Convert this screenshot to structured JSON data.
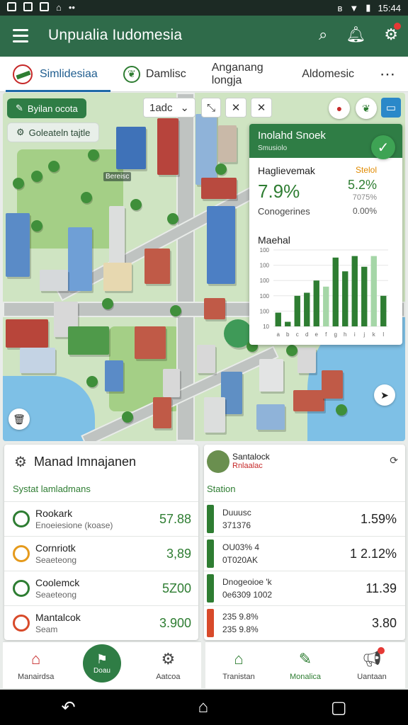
{
  "status": {
    "time": "15:44"
  },
  "appbar": {
    "title": "Unpualia Iudomesia"
  },
  "tabs": [
    {
      "label": "Simlidesiaa"
    },
    {
      "label": "Damlisc"
    },
    {
      "label": "Anganang longja"
    },
    {
      "label": "Aldomesic"
    }
  ],
  "map": {
    "chip_primary": "Byilan ocota",
    "chip_secondary": "Goleateln tajtle",
    "toolbar_label": "1adc",
    "street_label": "Bereisc"
  },
  "panel": {
    "title": "Inolahd Snoek",
    "subtitle": "Smusiolo",
    "metric_label": "Haglievemak",
    "metric_right_label": "Stelol",
    "metric_value": "7.9%",
    "metric_right_value": "5.2%",
    "secondary_label": "Conogerines",
    "small_value": "7075%",
    "secondary_value": "0.00%",
    "chart_title": "Maehal"
  },
  "chart_data": {
    "type": "bar",
    "title": "Maehal",
    "y_ticks": [
      "100",
      "100",
      "100",
      "100",
      "100",
      "10"
    ],
    "categories": [
      "a",
      "b",
      "c",
      "d",
      "e",
      "f",
      "g",
      "h",
      "i",
      "j",
      "k",
      "l"
    ],
    "values": [
      18,
      6,
      40,
      44,
      60,
      52,
      90,
      72,
      92,
      78,
      92,
      40
    ],
    "ylim": [
      0,
      100
    ],
    "colors": [
      "#2e7d32",
      "#a5d6a7"
    ]
  },
  "left_card": {
    "title": "Manad Imnajanen",
    "subtitle": "Systat lamladmans",
    "items": [
      {
        "name": "Rookark",
        "sub": "Enoeiesione (koase)",
        "value": "57.88",
        "color": "#2e7d32"
      },
      {
        "name": "Cornriotk",
        "sub": "Seaeteong",
        "value": "3,89",
        "color": "#e59a1c"
      },
      {
        "name": "Coolemck",
        "sub": "Seaeteong",
        "value": "5Z00",
        "color": "#2e7d32"
      },
      {
        "name": "Mantalcok",
        "sub": "Seam",
        "value": "3.900",
        "color": "#d84a2a"
      }
    ]
  },
  "right_card": {
    "title": "Santalock",
    "subtitle": "Rnlaalac",
    "section": "Station",
    "items": [
      {
        "name": "Duuusc",
        "sub": "371376",
        "value": "1.59%",
        "color": "#2e7d32"
      },
      {
        "name": "OU03% 4",
        "sub": "0T020AK",
        "value": "1 2.12%",
        "color": "#2e7d32"
      },
      {
        "name": "Dnogeoioe 'k",
        "sub": "0e6309 1002",
        "value": "11.39",
        "color": "#2e7d32"
      },
      {
        "name": "235 9.8%",
        "sub": "235 9.8%",
        "value": "3.80",
        "color": "#d84a2a"
      }
    ]
  },
  "nav_left": [
    {
      "label": "Manairdsa"
    },
    {
      "label": "Doau"
    },
    {
      "label": "Aatcoa"
    }
  ],
  "nav_right": [
    {
      "label": "Tranistan"
    },
    {
      "label": "Monalica"
    },
    {
      "label": "Uantaan"
    }
  ]
}
